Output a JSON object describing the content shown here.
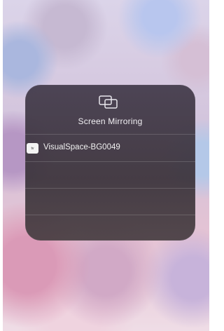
{
  "panel": {
    "title": "Screen Mirroring",
    "icon": "screen-mirroring-icon"
  },
  "devices": [
    {
      "label": "VisualSpace-BG0049",
      "icon": "apple-tv-icon",
      "icon_text": "tv"
    }
  ]
}
